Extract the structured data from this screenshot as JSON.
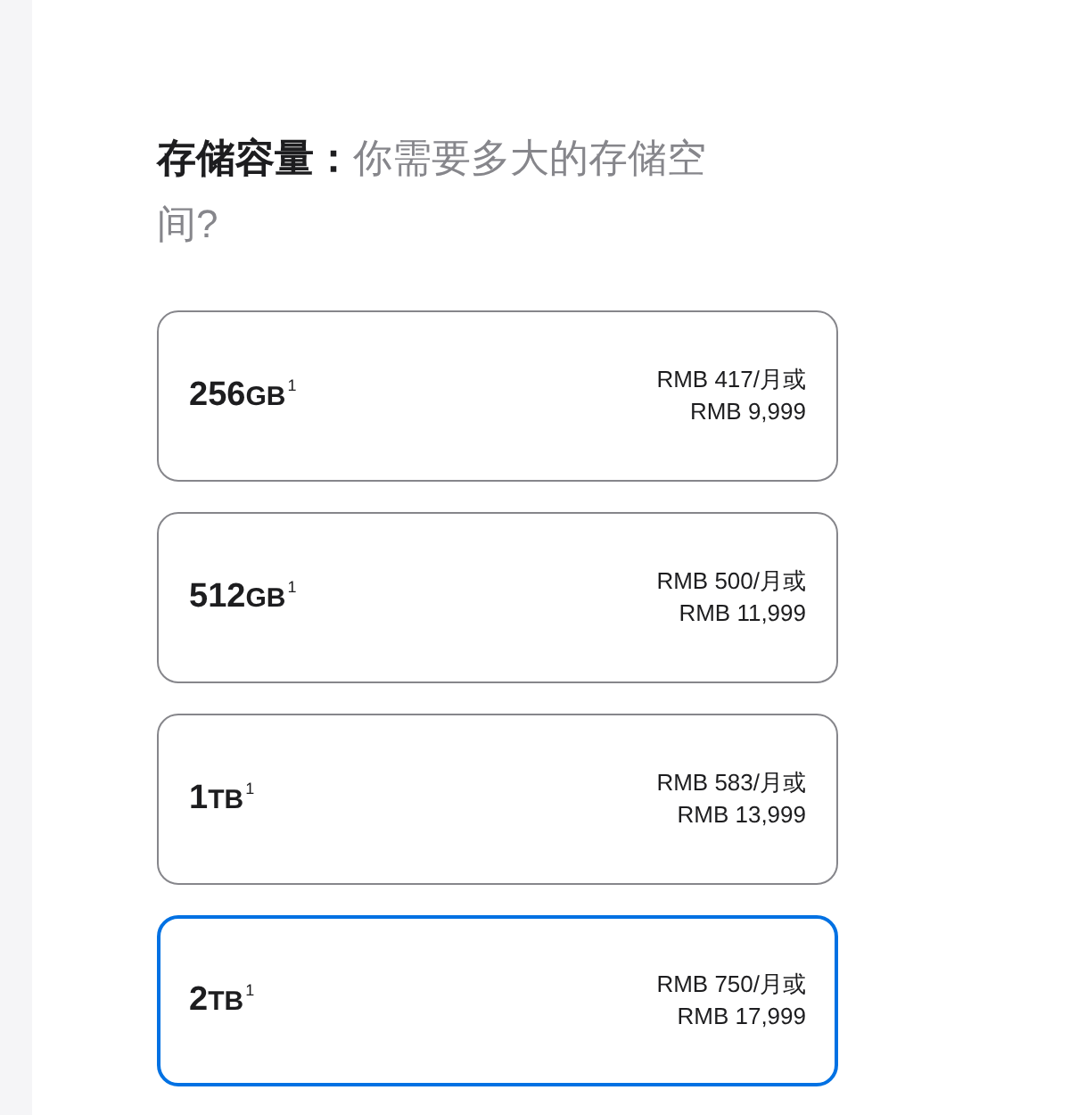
{
  "heading": "**存储容量：**你需要多大的存储空间?",
  "options": [
    {
      "size": "256",
      "unit": "GB",
      "footnote": "1",
      "monthly": "RMB 417/月或",
      "price": "RMB 9,999",
      "selected": false
    },
    {
      "size": "512",
      "unit": "GB",
      "footnote": "1",
      "monthly": "RMB 500/月或",
      "price": "RMB 11,999",
      "selected": false
    },
    {
      "size": "1",
      "unit": "TB",
      "footnote": "1",
      "monthly": "RMB 583/月或",
      "price": "RMB 13,999",
      "selected": false
    },
    {
      "size": "2",
      "unit": "TB",
      "footnote": "1",
      "monthly": "RMB 750/月或",
      "price": "RMB 17,999",
      "selected": true
    }
  ]
}
